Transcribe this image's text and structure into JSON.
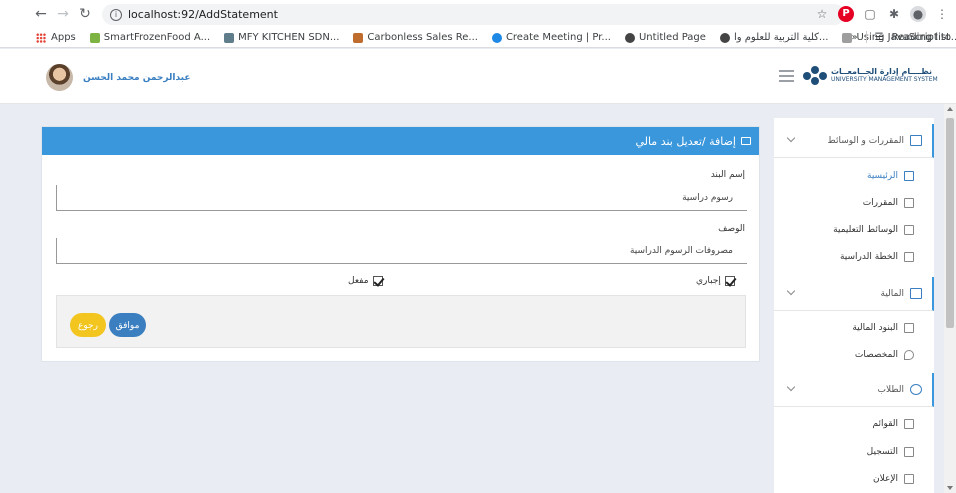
{
  "browser": {
    "url": "localhost:92/AddStatement",
    "bookmarks": [
      {
        "label": "Apps",
        "color": "#e34234"
      },
      {
        "label": "SmartFrozenFood A...",
        "color": "#7cb342"
      },
      {
        "label": "MFY KITCHEN SDN...",
        "color": "#607d8b"
      },
      {
        "label": "Carbonless Sales Re...",
        "color": "#bf6d2e"
      },
      {
        "label": "Create Meeting | Pr...",
        "color": "#1e88e5"
      },
      {
        "label": "Untitled Page",
        "color": "#444444"
      },
      {
        "label": "كلية التربية للعلوم وا...",
        "color": "#444444"
      },
      {
        "label": "Using JavaScript to...",
        "color": "#9e9e9e"
      }
    ],
    "reading_list": "Reading list",
    "more": "»"
  },
  "header": {
    "user_name": "عبدالرحمن محمد الحسن",
    "logo_line1": "نظــــام إدارة الجــامعــات",
    "logo_line2": "UNIVERSITY MANAGEMENT SYSTEM"
  },
  "panel": {
    "title": "إضافة /تعديل بند مالي",
    "field1_label": "إسم البند",
    "field1_value": "رسوم دراسية",
    "field2_label": "الوصف",
    "field2_value": "مصروفات الرسوم الدراسية",
    "check1_label": "إجباري",
    "check2_label": "مفعل",
    "ok_label": "موافق",
    "back_label": "رجوع"
  },
  "sidebar": {
    "group1": "المقررات و الوسائط",
    "group1_items": [
      "الرئيسية",
      "المقررات",
      "الوسائط التعليمية",
      "الخطة الدراسية"
    ],
    "group2": "المالية",
    "group2_items": [
      "البنود المالية",
      "المخصصات"
    ],
    "group3": "الطلاب",
    "group3_items": [
      "القوائم",
      "التسجيل",
      "الإعلان"
    ]
  },
  "colors": {
    "accent": "#3a97dc",
    "ok_button": "#3c7fc0",
    "back_button": "#f2c51f"
  }
}
